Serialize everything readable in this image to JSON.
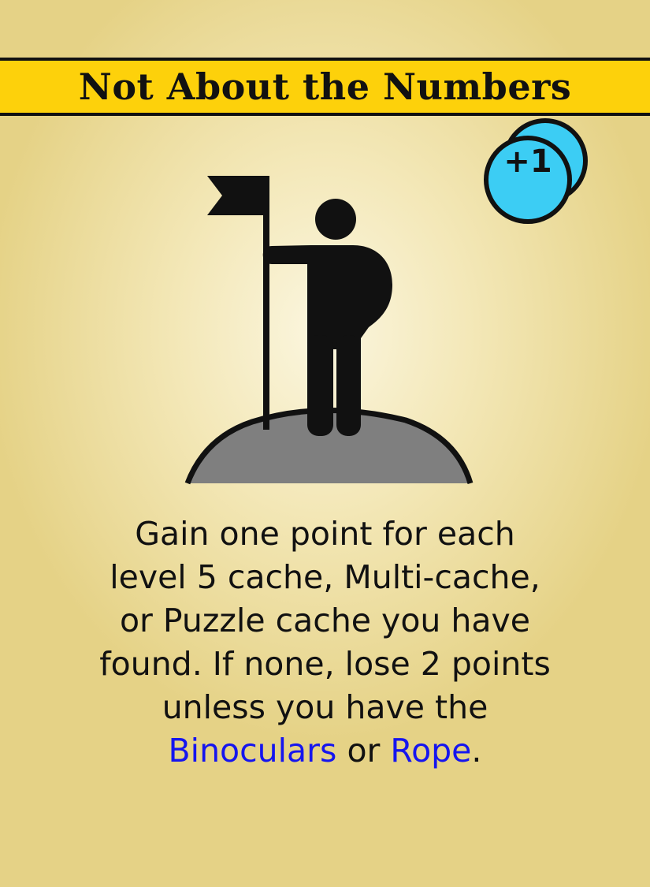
{
  "card": {
    "title": "Not About the Numbers",
    "badge": {
      "label": "+1",
      "color": "#3ccdf4"
    },
    "icons": {
      "illustration": "person-with-flag-on-hill-icon",
      "badge": "stacked-coins-icon"
    },
    "rule": {
      "lines": [
        "Gain one point for each",
        "level 5 cache, Multi-cache,",
        "or Puzzle cache you have",
        "found. If none, lose 2 points",
        "unless you have the"
      ],
      "keyword_1": "Binoculars",
      "connector": " or ",
      "keyword_2": "Rope",
      "ending": "."
    },
    "colors": {
      "title_bar": "#fdd10b",
      "keyword": "#1515ee",
      "hill": "#7f7f7f"
    }
  }
}
